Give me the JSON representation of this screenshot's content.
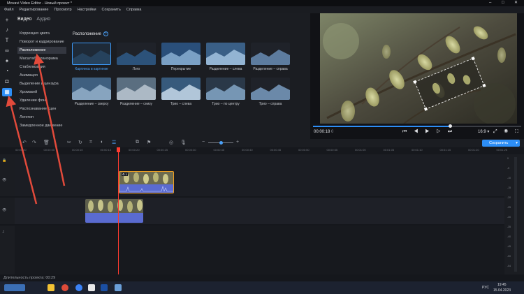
{
  "window": {
    "title": "Movavi Video Editor - Новый проект *",
    "controls": [
      "–",
      "□",
      "✕"
    ]
  },
  "menu": [
    "Файл",
    "Редактирование",
    "Просмотр",
    "Настройки",
    "Сохранить",
    "Справка"
  ],
  "tool_rail": [
    {
      "icon": "plus-icon",
      "glyph": "+"
    },
    {
      "icon": "music-note-icon",
      "glyph": "♪"
    },
    {
      "icon": "text-icon",
      "glyph": "T"
    },
    {
      "icon": "transitions-icon",
      "glyph": "∞"
    },
    {
      "icon": "filters-icon",
      "glyph": "✦"
    },
    {
      "icon": "motion-icon",
      "glyph": "◔"
    },
    {
      "icon": "stickers-icon",
      "glyph": "◘"
    },
    {
      "icon": "more-tools-icon",
      "glyph": "▦"
    }
  ],
  "tabs": {
    "video": "Видео",
    "audio": "Аудио"
  },
  "categories": [
    "Коррекция цвета",
    "Поворот и кадрирование",
    "Расположение",
    "Масштаб и панорама",
    "Стабилизация",
    "Анимация",
    "Выделение и цензура",
    "Хромакей",
    "Удаление фона",
    "Распознавание сцен",
    "Логотип",
    "Замедленное движение"
  ],
  "selected_category": 2,
  "effects": {
    "heading": "Расположение",
    "help": "?",
    "tiles": [
      "Картинка в картинке",
      "Лого",
      "Перекрытие",
      "Разделение – слева",
      "Разделение – справа",
      "Разделение – сверху",
      "Разделение – снизу",
      "Трио – слева",
      "Трио – по центру",
      "Трио – справа"
    ],
    "selected_tile": 0
  },
  "player": {
    "timecode": "00:00:18",
    "timecode_ms": "0",
    "progress": 0.66,
    "controls": "⏮ ◀ ▶ ▷ ⏭",
    "aspect": "16:9 ▾",
    "right_controls": "⤢ ◉ ⛶"
  },
  "toolbar": {
    "save_label": "Сохранить",
    "save_arrow": "▾"
  },
  "ruler": [
    "00:00:00",
    "00:00:05",
    "00:00:10",
    "00:00:15",
    "00:00:20",
    "00:00:25",
    "00:00:30",
    "00:00:35",
    "00:00:40",
    "00:00:45",
    "00:00:50",
    "00:00:55",
    "00:01:00",
    "00:01:05",
    "00:01:10",
    "00:01:15",
    "00:01:20",
    "00:01:25"
  ],
  "clip_badge": "⚙ 1",
  "meter_ticks": [
    "0",
    "-5",
    "-10",
    "-15",
    "-20",
    "-25",
    "-30",
    "-35",
    "-40",
    "-45",
    "-50",
    "-54"
  ],
  "status": "Длительность проекта: 00:29",
  "tray": {
    "lang": "РУС",
    "time": "19:45",
    "date": "15.04.2023"
  },
  "colors": {
    "accent": "#2d8ef6",
    "playhead": "#ff3b30",
    "clip_border": "#f0a020",
    "audio_clip": "#5a6bd0",
    "annotation": "#e24a3b"
  }
}
